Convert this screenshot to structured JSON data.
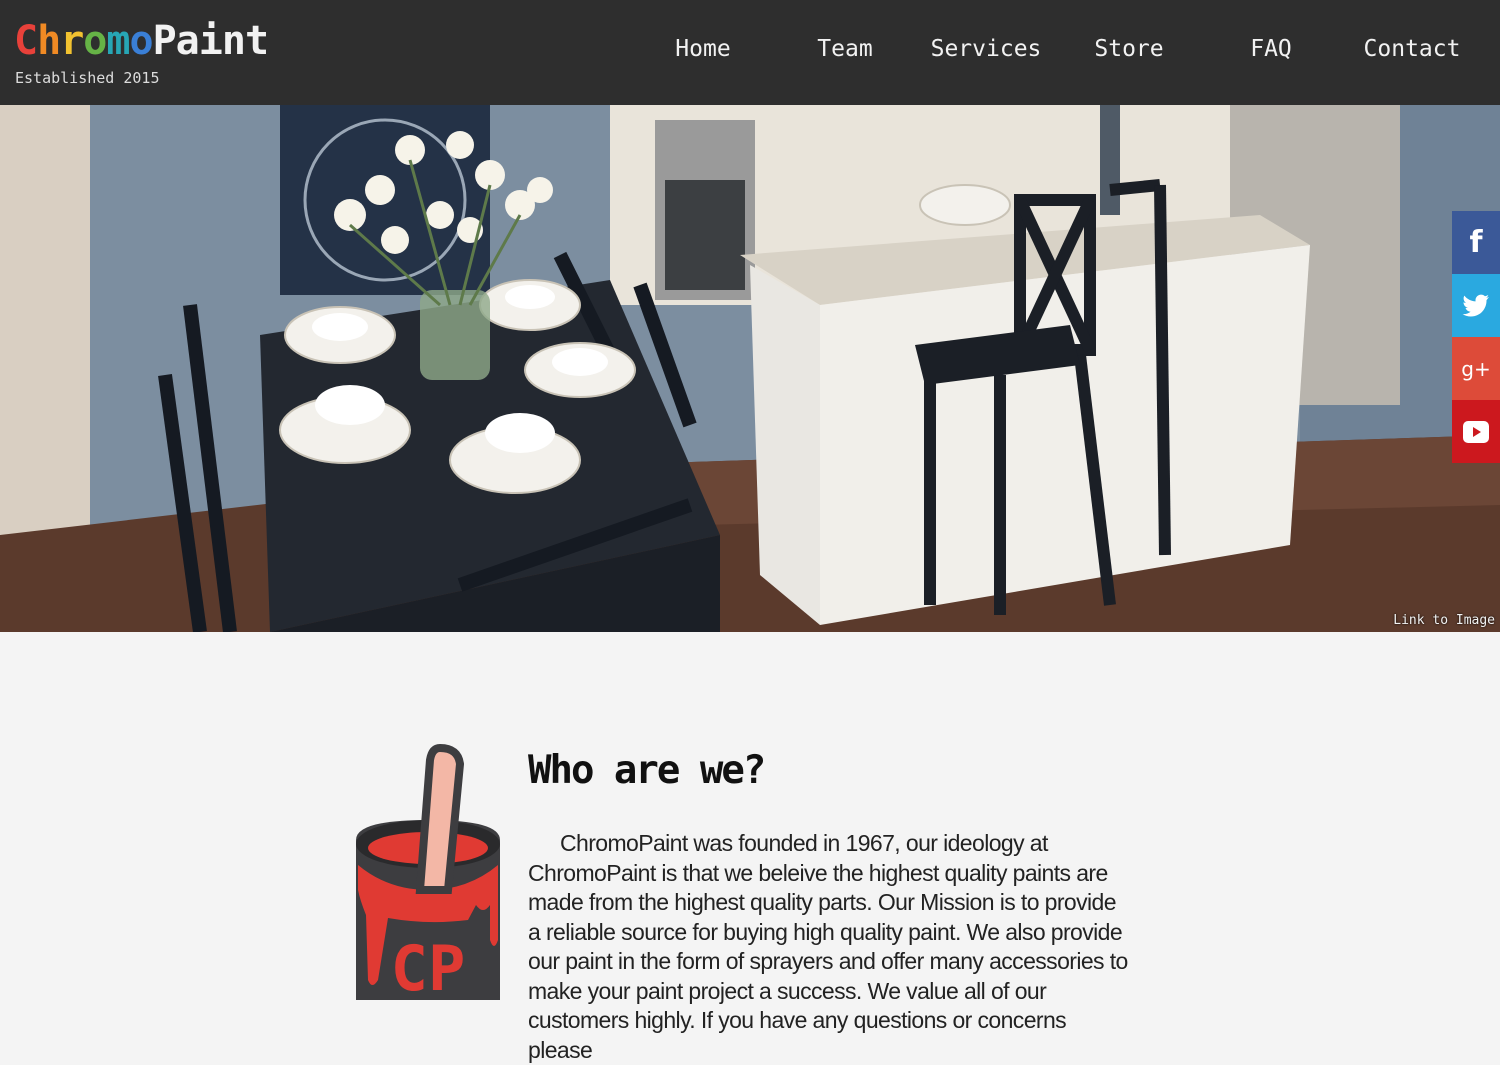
{
  "brand": {
    "name_letters": [
      {
        "ch": "C",
        "color": "#e8413a"
      },
      {
        "ch": "h",
        "color": "#f08a24"
      },
      {
        "ch": "r",
        "color": "#f2c230"
      },
      {
        "ch": "o",
        "color": "#66b346"
      },
      {
        "ch": "m",
        "color": "#27a6b5"
      },
      {
        "ch": "o",
        "color": "#3a7fd6"
      },
      {
        "ch": "P",
        "color": "#f2f2f2"
      },
      {
        "ch": "a",
        "color": "#f2f2f2"
      },
      {
        "ch": "i",
        "color": "#f2f2f2"
      },
      {
        "ch": "n",
        "color": "#f2f2f2"
      },
      {
        "ch": "t",
        "color": "#f2f2f2"
      }
    ],
    "tagline": "Established 2015"
  },
  "nav": {
    "items": [
      {
        "label": "Home"
      },
      {
        "label": "Team"
      },
      {
        "label": "Services"
      },
      {
        "label": "Store"
      },
      {
        "label": "FAQ"
      },
      {
        "label": "Contact"
      }
    ]
  },
  "hero": {
    "image_link": "Link to Image"
  },
  "social": {
    "items": [
      {
        "icon": "facebook-icon",
        "color": "#3b5998"
      },
      {
        "icon": "twitter-icon",
        "color": "#2aa9e0"
      },
      {
        "icon": "google-plus-icon",
        "color": "#dd4b39"
      },
      {
        "icon": "youtube-icon",
        "color": "#cc181e"
      }
    ]
  },
  "about": {
    "title": "Who are we?",
    "body": "ChromoPaint was founded in 1967, our ideology at ChromoPaint is that we beleive the highest quality paints are made from the highest quality parts. Our Mission is to provide a reliable source for buying high quality paint. We also provide our paint in the form of sprayers and offer many accessories to make your paint project a success. We value all of our customers highly. If you have any questions or concerns please",
    "logo_text": "CP"
  }
}
